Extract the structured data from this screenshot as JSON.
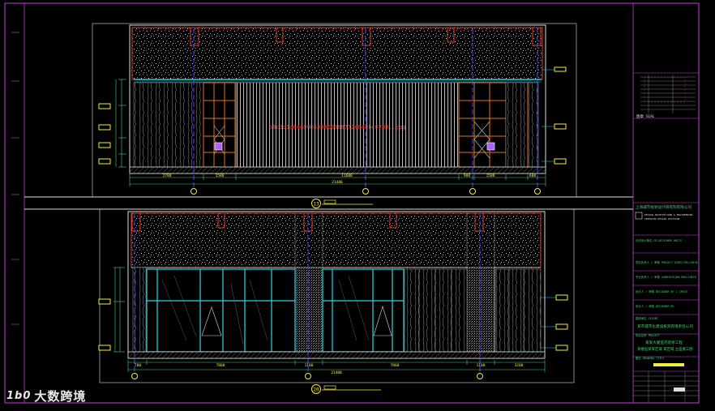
{
  "drawing": {
    "upper_view": {
      "section_mark": "13",
      "overlay_text": "b0c3d1a64e04b530060088772eb4ebc0783..jpg",
      "dims_bottom": [
        "2780",
        "1500",
        "11600",
        "900",
        "1500",
        "600"
      ],
      "dims_total": "21400",
      "left_dims": [
        "20",
        "1200",
        "2400",
        "800",
        "600"
      ],
      "mark_labels": [
        "A",
        "B",
        "C"
      ]
    },
    "lower_view": {
      "section_mark": "20",
      "dims_bottom": [
        "780",
        "7800",
        "1100",
        "7800",
        "1100",
        "3200"
      ],
      "dims_total": "21400",
      "left_dims": [
        "800",
        "2400"
      ],
      "mark_labels": [
        "A",
        "B",
        "C"
      ]
    },
    "title_block": {
      "seal_label": "图章 SEAL",
      "company_line": "上海城市规划设计研究院有限公司",
      "company_en_1": "DESIGN ARCHITECTURE & ENGINEERING",
      "company_en_2": "INTERIOR DESIGN DIVISION",
      "field_labels": [
        "合作设计单位 CO-DESIGNER UNITS",
        "项目负责人 / 审核 PROJECT DIRECTOR/CHECK",
        "专业负责人 / 审核 SUBDIVISION MGR/CHECK",
        "设计人 / 审核 DESIGNER BY / CHECK",
        "设计人 / 审核 DESIGNER BY",
        "建设单位 CLIENT",
        "项目名称 PROJECT",
        "图名 DRAWING TITLE"
      ],
      "client_value": "某市城市化建设投资有限责任公司",
      "project_value_1": "某某大厦室内装修工程",
      "project_value_2": "某楼层某某区域 某区域 立面施工图"
    }
  },
  "watermark": {
    "logo": "1b0",
    "text": "大数跨境"
  },
  "colors": {
    "background": "#000000",
    "border": "#c53ed6",
    "frame_white": "#dcdcdc",
    "red": "#e23a2f",
    "orange": "#d9762a",
    "cyan": "#2ad6e8",
    "yellow": "#f2ec3c",
    "blue": "#3b4bff",
    "dim_green": "#4fd07a",
    "grey": "#9a9a9a"
  }
}
